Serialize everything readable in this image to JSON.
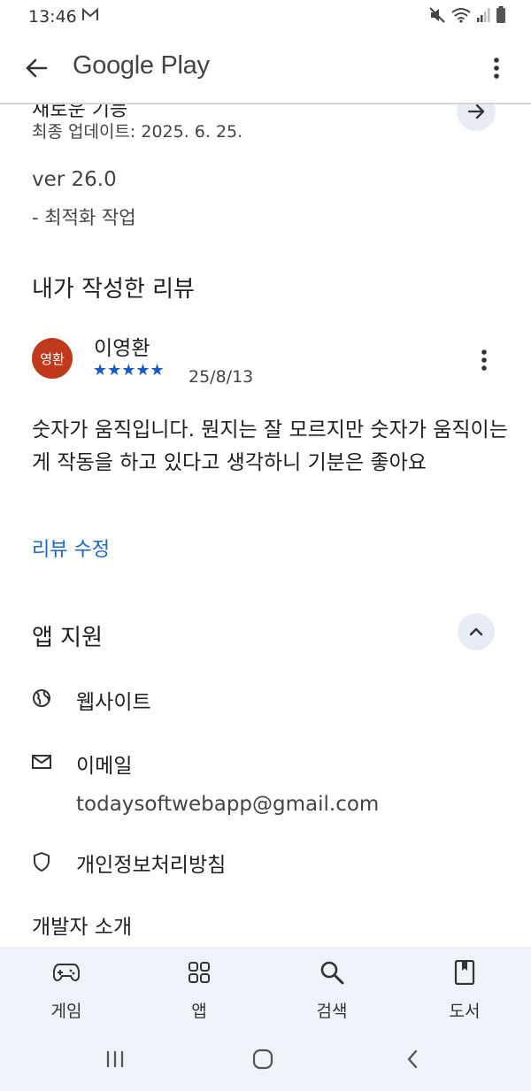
{
  "status_bar": {
    "time": "13:46"
  },
  "app_bar": {
    "title": "Google Play"
  },
  "whats_new": {
    "partial_title": "새로운 기능",
    "last_updated": "최종 업데이트: 2025. 6. 25.",
    "version": "ver 26.0",
    "change": "- 최적화 작업"
  },
  "my_review": {
    "section_title": "내가 작성한 리뷰",
    "avatar_text": "영환",
    "reviewer_name": "이영환",
    "rating": 5,
    "stars": "★★★★★",
    "date": "25/8/13",
    "body": "숫자가 움직입니다. 뭔지는 잘 모르지만 숫자가 움직이는게 작동을 하고 있다고 생각하니 기분은 좋아요",
    "edit_link": "리뷰 수정"
  },
  "app_support": {
    "section_title": "앱 지원",
    "website_label": "웹사이트",
    "email_label": "이메일",
    "email_address": "todaysoftwebapp@gmail.com",
    "privacy_label": "개인정보처리방침",
    "developer_intro": "개발자 소개"
  },
  "bottom_nav": {
    "items": [
      {
        "label": "게임",
        "icon": "gamepad-icon"
      },
      {
        "label": "앱",
        "icon": "apps-grid-icon"
      },
      {
        "label": "검색",
        "icon": "search-icon"
      },
      {
        "label": "도서",
        "icon": "book-icon"
      }
    ]
  },
  "colors": {
    "accent_blue": "#1a67c4",
    "avatar_bg": "#c0391b",
    "nav_bg": "#eef2f9"
  }
}
